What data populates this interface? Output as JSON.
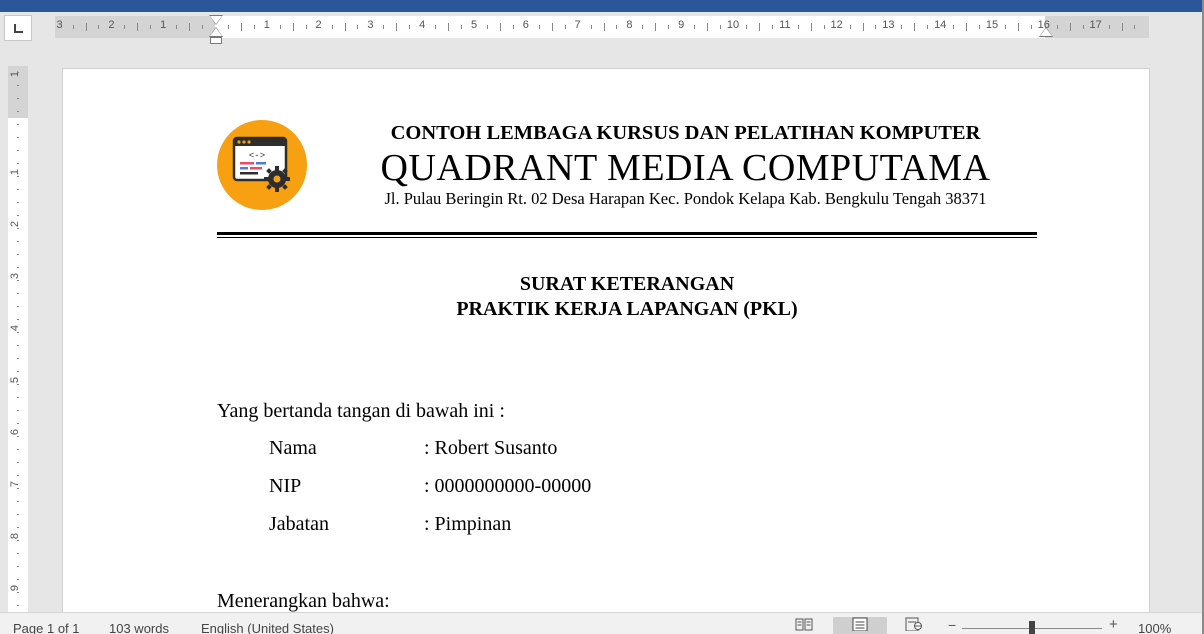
{
  "ruler": {
    "horizontal_left": [
      "3",
      "2",
      "1"
    ],
    "horizontal_right": [
      "1",
      "2",
      "3",
      "4",
      "5",
      "6",
      "7",
      "8",
      "9",
      "10",
      "11",
      "12",
      "13",
      "14",
      "15",
      "16",
      "17"
    ],
    "vertical": [
      "1",
      "1",
      "2",
      "3",
      "4",
      "5",
      "6",
      "7",
      "8",
      "9"
    ]
  },
  "document": {
    "letterhead": {
      "line1": "CONTOH LEMBAGA KURSUS DAN PELATIHAN KOMPUTER",
      "line2": "QUADRANT MEDIA COMPUTAMA",
      "address": "Jl. Pulau Beringin Rt. 02 Desa Harapan Kec. Pondok Kelapa Kab. Bengkulu Tengah 38371",
      "logo_glyph": "<->"
    },
    "title_line1": "SURAT KETERANGAN",
    "title_line2": "PRAKTIK KERJA LAPANGAN (PKL)",
    "intro": "Yang bertanda tangan di bawah ini :",
    "fields": [
      {
        "label": "Nama",
        "value": ": Robert Susanto"
      },
      {
        "label": "NIP",
        "value": ": 0000000000-00000"
      },
      {
        "label": "Jabatan",
        "value": ": Pimpinan"
      }
    ],
    "closing": "Menerangkan bahwa:"
  },
  "statusbar": {
    "page": "Page 1 of 1",
    "words": "103 words",
    "language": "English (United States)",
    "zoom_minus": "−",
    "zoom_plus": "+",
    "zoom": "100%",
    "zoom_fraction": 0.5
  },
  "colors": {
    "accent": "#2b579a",
    "logo_orange": "#f6a012"
  },
  "icons": {
    "tab_selector": "tab-stop-left-icon",
    "read_mode": "read-mode-icon",
    "print_layout": "print-layout-icon",
    "web_layout": "web-layout-icon"
  }
}
